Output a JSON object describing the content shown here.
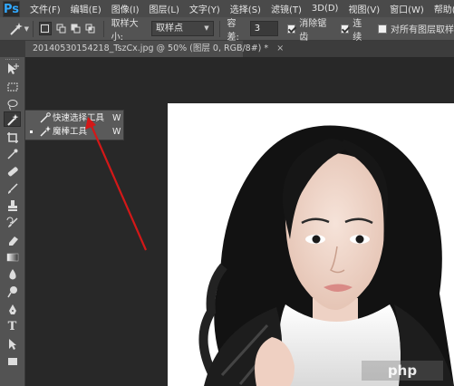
{
  "app": {
    "logo": "Ps"
  },
  "menu": [
    "文件(F)",
    "编辑(E)",
    "图像(I)",
    "图层(L)",
    "文字(Y)",
    "选择(S)",
    "滤镜(T)",
    "3D(D)",
    "视图(V)",
    "窗口(W)",
    "帮助(H)"
  ],
  "options": {
    "sample_size_label": "取样大小:",
    "sample_size_value": "取样点",
    "tolerance_label": "容差:",
    "tolerance_value": "3",
    "anti_alias_label": "消除锯齿",
    "contiguous_label": "连续",
    "all_layers_label": "对所有图层取样"
  },
  "document": {
    "tab_title": "20140530154218_TszCx.jpg @ 50% (图层 0, RGB/8#) *",
    "close": "×"
  },
  "flyout": {
    "items": [
      {
        "label": "快速选择工具",
        "key": "W",
        "active": false
      },
      {
        "label": "魔棒工具",
        "key": "W",
        "active": true
      }
    ]
  },
  "watermark": {
    "text": "php"
  },
  "colors": {
    "arrow": "#d31818",
    "accent": "#31a8ff"
  }
}
